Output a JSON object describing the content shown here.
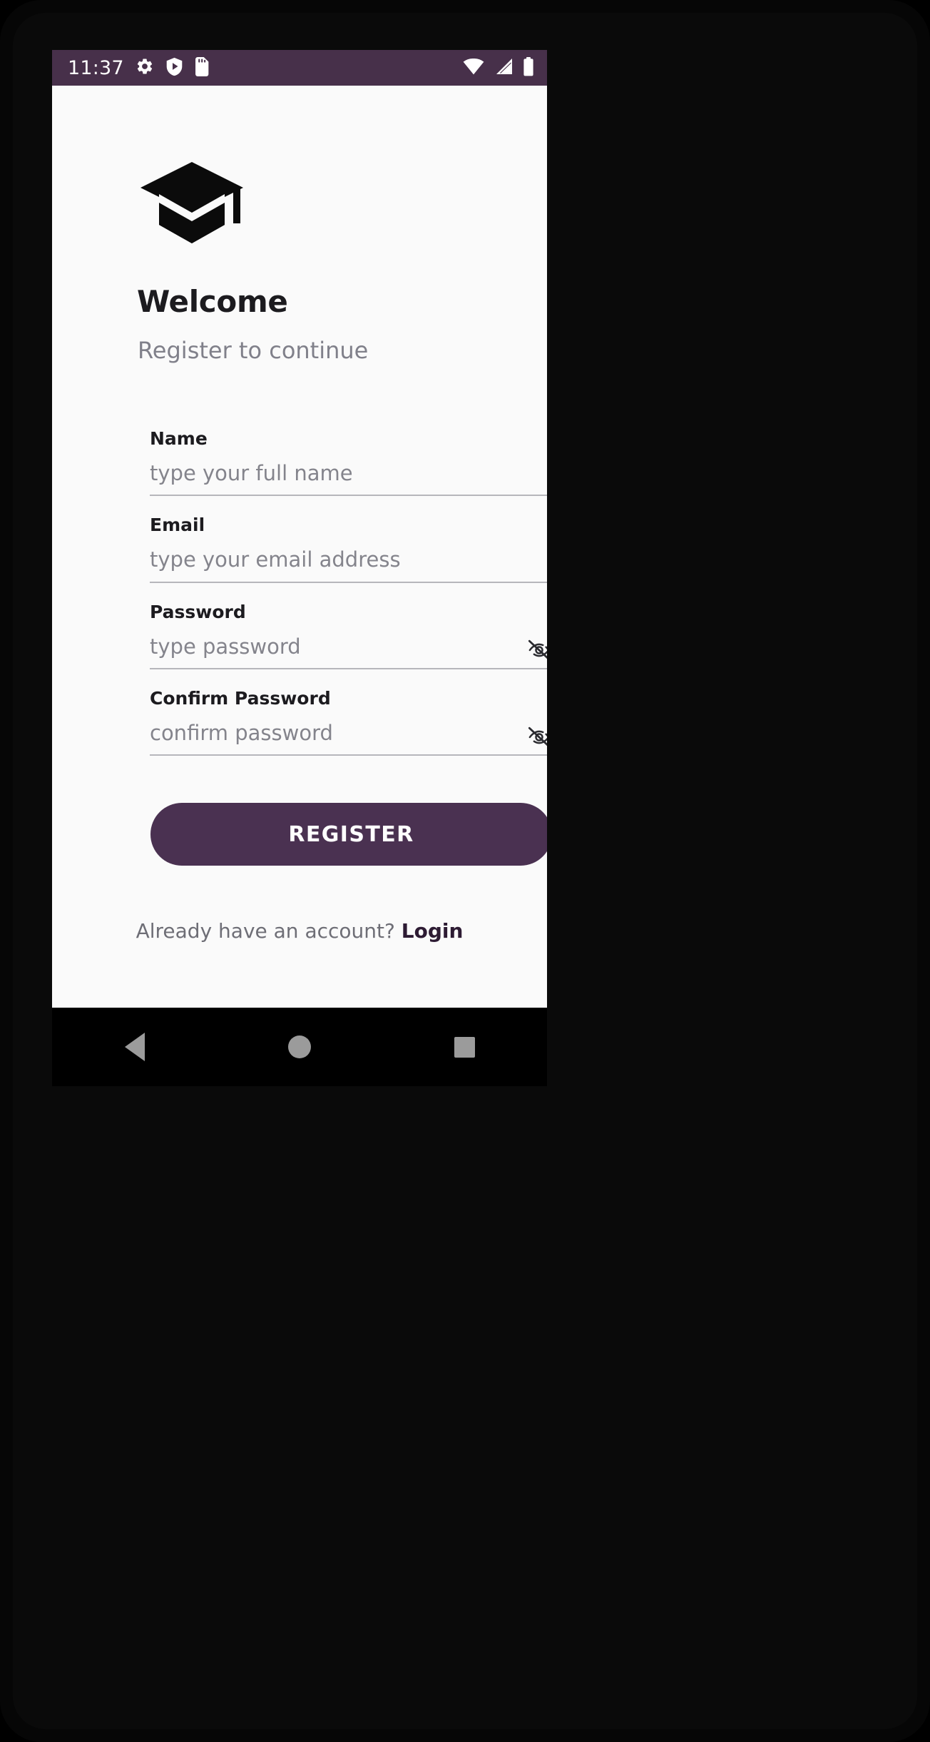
{
  "status_bar": {
    "time": "11:37",
    "left_icons": [
      "gear-icon",
      "shield-play-icon",
      "sd-card-icon"
    ],
    "right_icons": [
      "wifi-icon",
      "cellular-signal-icon",
      "battery-icon"
    ],
    "background_color": "#47304a",
    "foreground_color": "#ffffff"
  },
  "screen": {
    "background_color": "#fafafa",
    "logo_icon": "graduation-cap-icon",
    "title": "Welcome",
    "subtitle": "Register to continue"
  },
  "form": {
    "fields": [
      {
        "name": "name",
        "label": "Name",
        "placeholder": "type your full name",
        "value": "",
        "has_toggle": false
      },
      {
        "name": "email",
        "label": "Email",
        "placeholder": "type your email address",
        "value": "",
        "has_toggle": false
      },
      {
        "name": "password",
        "label": "Password",
        "placeholder": "type password",
        "value": "",
        "has_toggle": true,
        "toggle_icon": "eye-off-icon"
      },
      {
        "name": "confirm_password",
        "label": "Confirm Password",
        "placeholder": "confirm password",
        "value": "",
        "has_toggle": true,
        "toggle_icon": "eye-off-icon"
      }
    ]
  },
  "actions": {
    "register_label": "REGISTER",
    "register_color": "#4a3151",
    "footer_text": "Already have an account?",
    "login_label": "Login",
    "login_color": "#2d1b33"
  },
  "nav_bar": {
    "back_label": "Back",
    "home_label": "Home",
    "recents_label": "Recents"
  }
}
